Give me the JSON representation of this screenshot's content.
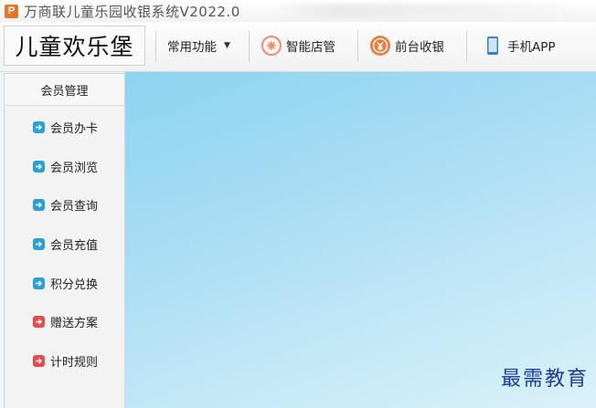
{
  "title_bar": {
    "app_icon_letter": "P",
    "title": "万商联儿童乐园收银系统V2022.0"
  },
  "toolbar": {
    "brand": "儿童欢乐堡",
    "common_functions": "常用功能",
    "smart_store": "智能店管",
    "front_desk": "前台收银",
    "mobile_app": "手机APP"
  },
  "sidebar": {
    "header": "会员管理",
    "items": [
      {
        "label": "会员办卡",
        "color": "#2a9fd8"
      },
      {
        "label": "会员浏览",
        "color": "#2a9fd8"
      },
      {
        "label": "会员查询",
        "color": "#2a9fd8"
      },
      {
        "label": "会员充值",
        "color": "#2a9fd8"
      },
      {
        "label": "积分兑换",
        "color": "#2a9fd8"
      },
      {
        "label": "赠送方案",
        "color": "#e64c4c"
      },
      {
        "label": "计时规则",
        "color": "#e64c4c"
      }
    ]
  },
  "watermark": "最需教育"
}
